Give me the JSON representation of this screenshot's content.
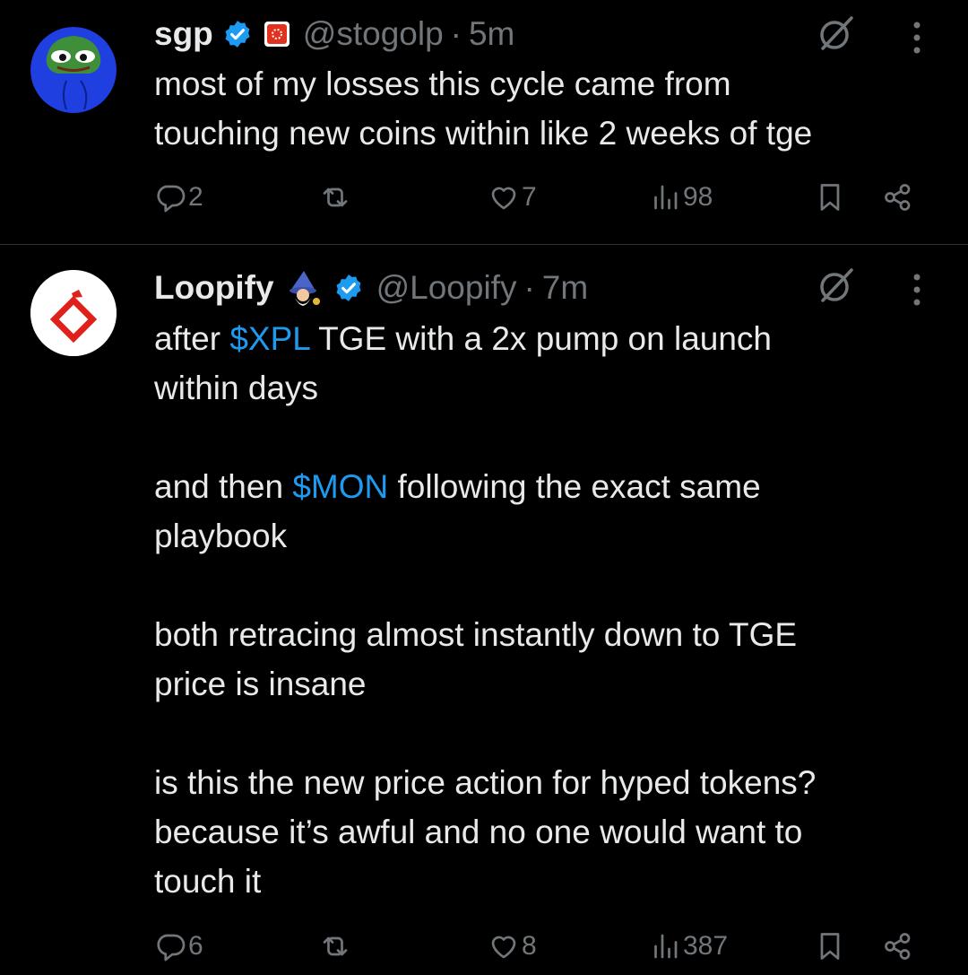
{
  "tweets": [
    {
      "name": "sgp",
      "handle": "@stogolp",
      "dot": "·",
      "time": "5m",
      "body": "most of my losses this cycle came from\ntouching new coins within like 2 weeks of tge",
      "replies": "2",
      "reposts": "",
      "likes": "7",
      "views": "98"
    },
    {
      "name": "Loopify",
      "handle": "@Loopify",
      "dot": "·",
      "time": "7m",
      "body_parts": {
        "p1a": "after ",
        "cashtag1": "$XPL",
        "p1b": " TGE with a 2x pump on launch\nwithin days",
        "p2a": "and then ",
        "cashtag2": "$MON",
        "p2b": " following the exact same\nplaybook",
        "p3": "both retracing almost instantly down to TGE\nprice is insane",
        "p4": "is this the new price action for hyped tokens?\nbecause it’s awful and no one would want to\ntouch it"
      },
      "replies": "6",
      "reposts": "",
      "likes": "8",
      "views": "387"
    }
  ],
  "colors": {
    "background": "#000000",
    "text": "#e7e9ea",
    "muted": "#71767b",
    "link": "#1d9bf0",
    "verified": "#1d9bf0",
    "divider": "#2f3336"
  }
}
